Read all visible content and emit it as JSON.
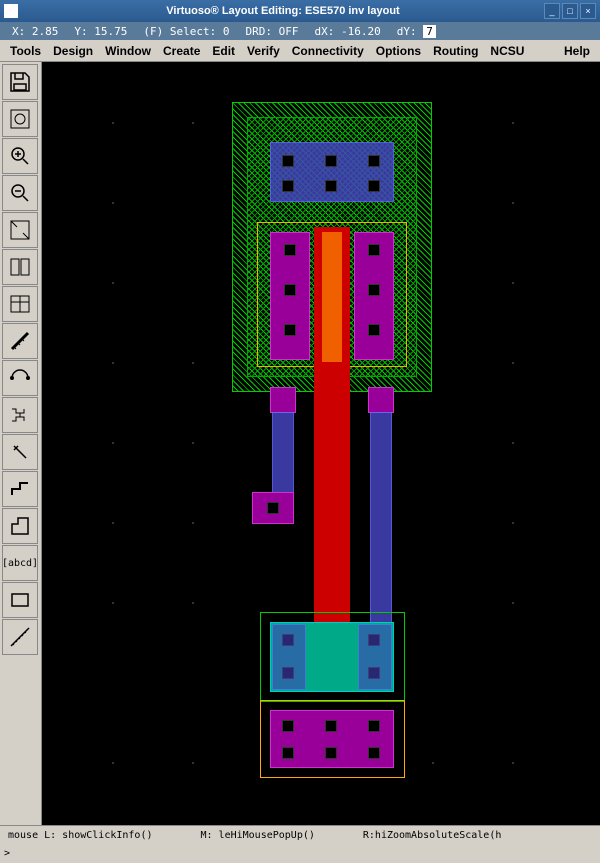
{
  "title": "Virtuoso® Layout Editing: ESE570 inv layout",
  "status": {
    "x_label": "X:",
    "x": "2.85",
    "y_label": "Y:",
    "y": "15.75",
    "select_label": "(F) Select:",
    "select": "0",
    "drd_label": "DRD:",
    "drd": "OFF",
    "dx_label": "dX:",
    "dx": "-16.20",
    "dy_label": "dY:",
    "dy_val": "7"
  },
  "menu": {
    "tools": "Tools",
    "design": "Design",
    "window": "Window",
    "create": "Create",
    "edit": "Edit",
    "verify": "Verify",
    "connectivity": "Connectivity",
    "options": "Options",
    "routing": "Routing",
    "ncsu": "NCSU",
    "help": "Help"
  },
  "footer": {
    "mouse_l": "mouse L: showClickInfo()",
    "mouse_m": "M: leHiMousePopUp()",
    "mouse_r": "R:hiZoomAbsoluteScale(h",
    "prompt": ">"
  },
  "toolbar_labels": {
    "save": "save-icon",
    "toggle": "toggle-icon",
    "zoom_in": "zoom-in-icon",
    "zoom_out": "zoom-out-icon",
    "fit": "fit-icon",
    "props": "properties-icon",
    "hierarchy": "hierarchy-icon",
    "ruler": "ruler-icon",
    "instance": "instance-icon",
    "pattern": "pattern-icon",
    "rotate": "rotate-icon",
    "path": "path-icon",
    "polygon": "polygon-icon",
    "label": "[abcd]",
    "rect": "rectangle-icon",
    "measure": "measure-icon"
  }
}
